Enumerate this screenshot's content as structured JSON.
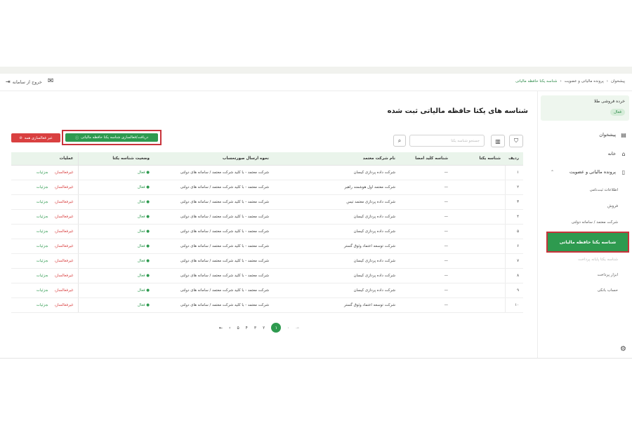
{
  "header": {
    "exit_label": "خروج از سامانه",
    "breadcrumb": [
      "پیشخوان",
      "پرونده مالیاتی و عضویت",
      "شناسه یکتا حافظه مالیاتی"
    ]
  },
  "sidebar": {
    "shop_title": "خرده فروشی طلا",
    "shop_status": "فعال",
    "menu": [
      "پیشخوان",
      "خانه",
      "پرونده مالیاتی و عضویت"
    ],
    "sub_items": [
      "اطلاعات ثبت‌نامی",
      "فروش",
      "شرکت معتمد / سامانه دولتی",
      "شناسه یکتا حافظه مالیاتی",
      "شناسه یکتا پایانه پرداخت",
      "ابزار پرداخت",
      "حساب بانکی"
    ]
  },
  "main": {
    "title": "شناسه های یکتا حافظه مالیاتی ثبت شده",
    "deactivate_all_label": "غیر فعالسازی همه",
    "fetch_label": "دریافت/فعالسازی شناسه یکتا حافظه مالیاتی",
    "search_placeholder": "جستجو شناسه یکتا"
  },
  "table": {
    "headers": [
      "ردیف",
      "شناسه یکتا",
      "شناسه کلید امضا",
      "نام شرکت معتمد",
      "نحوه ارسال صورتحساب",
      "وضعیت شناسه یکتا",
      "عملیات"
    ],
    "rows": [
      {
        "idx": "۱",
        "uid": "",
        "key": "—",
        "company": "شرکت داده پردازی کیسان",
        "method": "شرکت معتمد - با کلید شرکت معتمد / سامانه های دولتی",
        "status": "فعال"
      },
      {
        "idx": "۲",
        "uid": "",
        "key": "—",
        "company": "شرکت معتمد اول هوشمند راهبر",
        "method": "شرکت معتمد - با کلید شرکت معتمد / سامانه های دولتی",
        "status": "فعال"
      },
      {
        "idx": "۳",
        "uid": "",
        "key": "—",
        "company": "شرکت داده پردازی معتمد تیس",
        "method": "شرکت معتمد - با کلید شرکت معتمد / سامانه های دولتی",
        "status": "فعال"
      },
      {
        "idx": "۴",
        "uid": "",
        "key": "—",
        "company": "شرکت داده پردازی کیسان",
        "method": "شرکت معتمد - با کلید شرکت معتمد / سامانه های دولتی",
        "status": "فعال"
      },
      {
        "idx": "۵",
        "uid": "",
        "key": "—",
        "company": "شرکت داده پردازی کیسان",
        "method": "شرکت معتمد - با کلید شرکت معتمد / سامانه های دولتی",
        "status": "فعال"
      },
      {
        "idx": "۶",
        "uid": "",
        "key": "—",
        "company": "شرکت توسعه اعتماد وثوق گستر",
        "method": "شرکت معتمد - با کلید شرکت معتمد / سامانه های دولتی",
        "status": "فعال"
      },
      {
        "idx": "۷",
        "uid": "",
        "key": "—",
        "company": "شرکت داده پردازی کیسان",
        "method": "شرکت معتمد - با کلید شرکت معتمد / سامانه های دولتی",
        "status": "فعال"
      },
      {
        "idx": "۸",
        "uid": "",
        "key": "—",
        "company": "شرکت داده پردازی کیسان",
        "method": "شرکت معتمد - با کلید شرکت معتمد / سامانه های دولتی",
        "status": "فعال"
      },
      {
        "idx": "۹",
        "uid": "",
        "key": "—",
        "company": "شرکت داده پردازی کیسان",
        "method": "شرکت معتمد - با کلید شرکت معتمد / سامانه های دولتی",
        "status": "فعال"
      },
      {
        "idx": "۱۰",
        "uid": "",
        "key": "—",
        "company": "شرکت توسعه اعتماد وثوق گستر",
        "method": "شرکت معتمد - با کلید شرکت معتمد / سامانه های دولتی",
        "status": "فعال"
      }
    ],
    "op_deactivate": "غیرفعالسازی",
    "op_details": "جزئیات"
  },
  "pagination": {
    "pages": [
      "۵",
      "۴",
      "۳",
      "۲"
    ],
    "current": "۱"
  },
  "colors": {
    "accent": "#2e9a4f",
    "danger": "#d94040",
    "highlight_border": "#c8333b"
  }
}
